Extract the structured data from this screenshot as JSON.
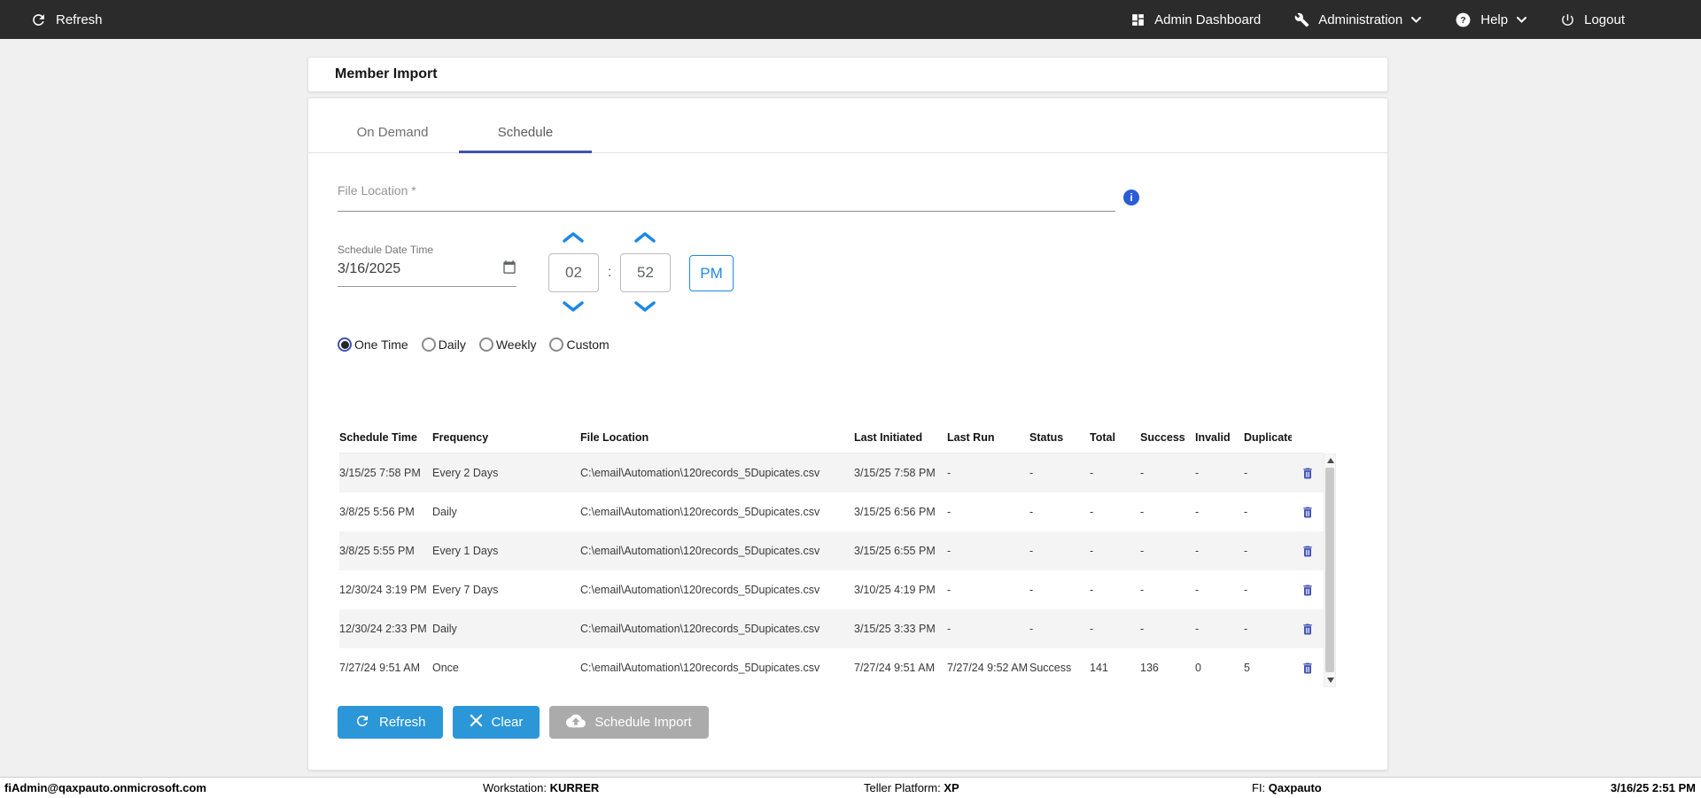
{
  "topbar": {
    "refresh_label": "Refresh",
    "admin_dashboard_label": "Admin Dashboard",
    "administration_label": "Administration",
    "help_label": "Help",
    "logout_label": "Logout"
  },
  "icons": {
    "help_glyph": "?",
    "info_glyph": "i"
  },
  "page": {
    "title": "Member Import"
  },
  "tabs": {
    "on_demand": "On Demand",
    "schedule": "Schedule",
    "active": "Schedule"
  },
  "form": {
    "file_location_placeholder": "File Location *",
    "schedule_date_time_label": "Schedule Date Time",
    "date_value": "3/16/2025",
    "hour": "02",
    "minute": "52",
    "time_separator": ":",
    "meridiem": "PM",
    "frequency_options": [
      {
        "label": "One Time",
        "selected": true
      },
      {
        "label": "Daily",
        "selected": false
      },
      {
        "label": "Weekly",
        "selected": false
      },
      {
        "label": "Custom",
        "selected": false
      }
    ]
  },
  "table": {
    "headers": [
      "Schedule Time",
      "Frequency",
      "File Location",
      "Last Initiated",
      "Last Run",
      "Status",
      "Total",
      "Success",
      "Invalid",
      "Duplicate"
    ],
    "rows": [
      {
        "schedule_time": "3/15/25 7:58 PM",
        "frequency": "Every 2 Days",
        "file_location": "C:\\email\\Automation\\120records_5Dupicates.csv",
        "last_initiated": "3/15/25 7:58 PM",
        "last_run": "-",
        "status": "-",
        "total": "-",
        "success": "-",
        "invalid": "-",
        "duplicate": "-"
      },
      {
        "schedule_time": "3/8/25 5:56 PM",
        "frequency": "Daily",
        "file_location": "C:\\email\\Automation\\120records_5Dupicates.csv",
        "last_initiated": "3/15/25 6:56 PM",
        "last_run": "-",
        "status": "-",
        "total": "-",
        "success": "-",
        "invalid": "-",
        "duplicate": "-"
      },
      {
        "schedule_time": "3/8/25 5:55 PM",
        "frequency": "Every 1 Days",
        "file_location": "C:\\email\\Automation\\120records_5Dupicates.csv",
        "last_initiated": "3/15/25 6:55 PM",
        "last_run": "-",
        "status": "-",
        "total": "-",
        "success": "-",
        "invalid": "-",
        "duplicate": "-"
      },
      {
        "schedule_time": "12/30/24 3:19 PM",
        "frequency": "Every 7 Days",
        "file_location": "C:\\email\\Automation\\120records_5Dupicates.csv",
        "last_initiated": "3/10/25 4:19 PM",
        "last_run": "-",
        "status": "-",
        "total": "-",
        "success": "-",
        "invalid": "-",
        "duplicate": "-"
      },
      {
        "schedule_time": "12/30/24 2:33 PM",
        "frequency": "Daily",
        "file_location": "C:\\email\\Automation\\120records_5Dupicates.csv",
        "last_initiated": "3/15/25 3:33 PM",
        "last_run": "-",
        "status": "-",
        "total": "-",
        "success": "-",
        "invalid": "-",
        "duplicate": "-"
      },
      {
        "schedule_time": "7/27/24 9:51 AM",
        "frequency": "Once",
        "file_location": "C:\\email\\Automation\\120records_5Dupicates.csv",
        "last_initiated": "7/27/24 9:51 AM",
        "last_run": "7/27/24 9:52 AM",
        "status": "Success",
        "total": "141",
        "success": "136",
        "invalid": "0",
        "duplicate": "5"
      }
    ]
  },
  "actions": {
    "refresh_label": "Refresh",
    "clear_label": "Clear",
    "schedule_import_label": "Schedule Import"
  },
  "footer": {
    "user": "fiAdmin@qaxpauto.onmicrosoft.com",
    "workstation_label": "Workstation:",
    "workstation_value": "KURRER",
    "teller_platform_label": "Teller Platform:",
    "teller_platform_value": "XP",
    "fi_label": "FI:",
    "fi_value": "Qaxpauto",
    "datetime": "3/16/25 2:51 PM"
  },
  "colors": {
    "topbar_bg": "#2c2b2b",
    "accent_indigo": "#3f51b5",
    "accent_blue": "#1e88e5",
    "button_blue": "#2b97d9",
    "disabled_gray": "#ababab",
    "info_blue": "#2a5cd5"
  }
}
